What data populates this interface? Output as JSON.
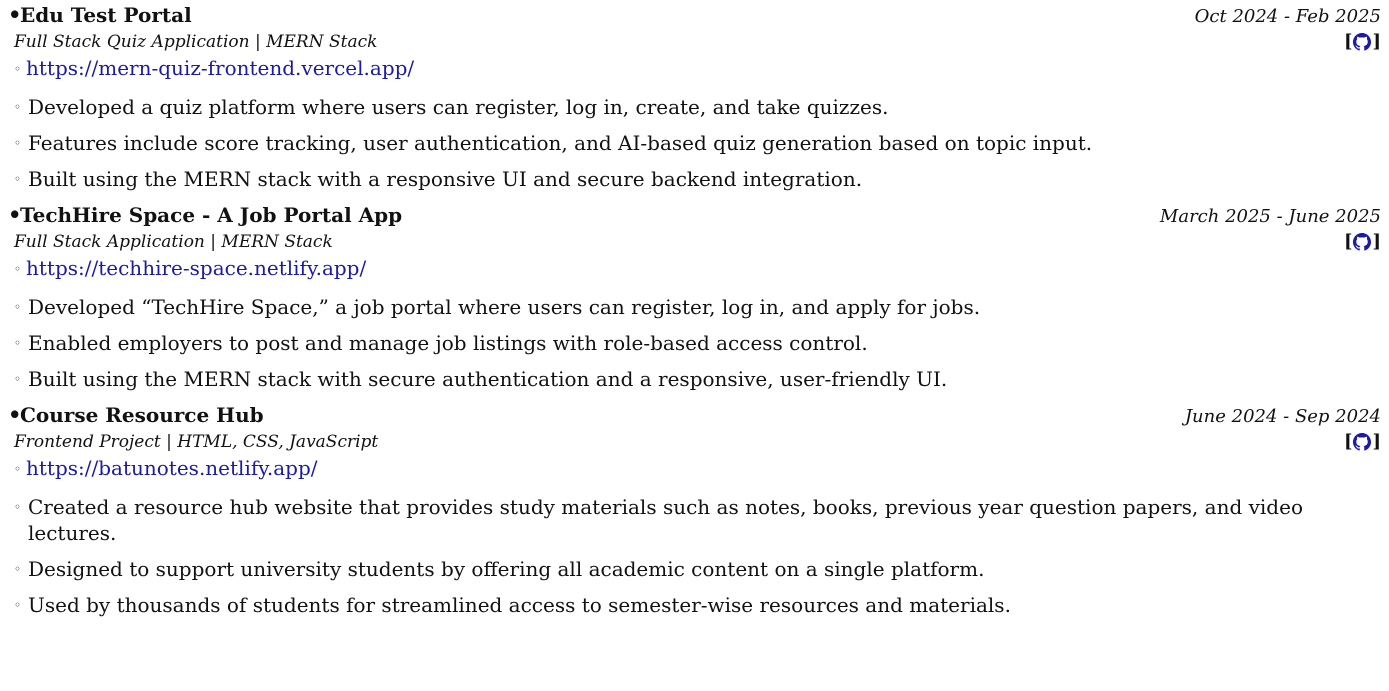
{
  "projects": [
    {
      "title": "Edu Test Portal",
      "dates": "Oct 2024 - Feb 2025",
      "subtitle": "Full Stack Quiz Application | MERN Stack",
      "link": "https://mern-quiz-frontend.vercel.app/",
      "github_icon": "github-icon",
      "points": [
        "Developed a quiz platform where users can register, log in, create, and take quizzes.",
        "Features include score tracking, user authentication, and AI-based quiz generation based on topic input.",
        "Built using the MERN stack with a responsive UI and secure backend integration."
      ]
    },
    {
      "title": "TechHire Space - A Job Portal App",
      "dates": "March 2025 - June 2025",
      "subtitle": "Full Stack Application | MERN Stack",
      "link": "https://techhire-space.netlify.app/",
      "github_icon": "github-icon",
      "points": [
        "Developed “TechHire Space,” a job portal where users can register, log in, and apply for jobs.",
        "Enabled employers to post and manage job listings with role-based access control.",
        "Built using the MERN stack with secure authentication and a responsive, user-friendly UI."
      ]
    },
    {
      "title": "Course Resource Hub",
      "dates": "June 2024 - Sep 2024",
      "subtitle": "Frontend Project | HTML, CSS, JavaScript",
      "link": "https://batunotes.netlify.app/",
      "github_icon": "github-icon",
      "points": [
        "Created a resource hub website that provides study materials such as notes, books, previous year question papers, and video lectures.",
        "Designed to support university students by offering all academic content on a single platform.",
        "Used by thousands of students for streamlined access to semester-wise resources and materials."
      ]
    }
  ],
  "colors": {
    "link": "#1a1aa6",
    "text": "#111111"
  }
}
